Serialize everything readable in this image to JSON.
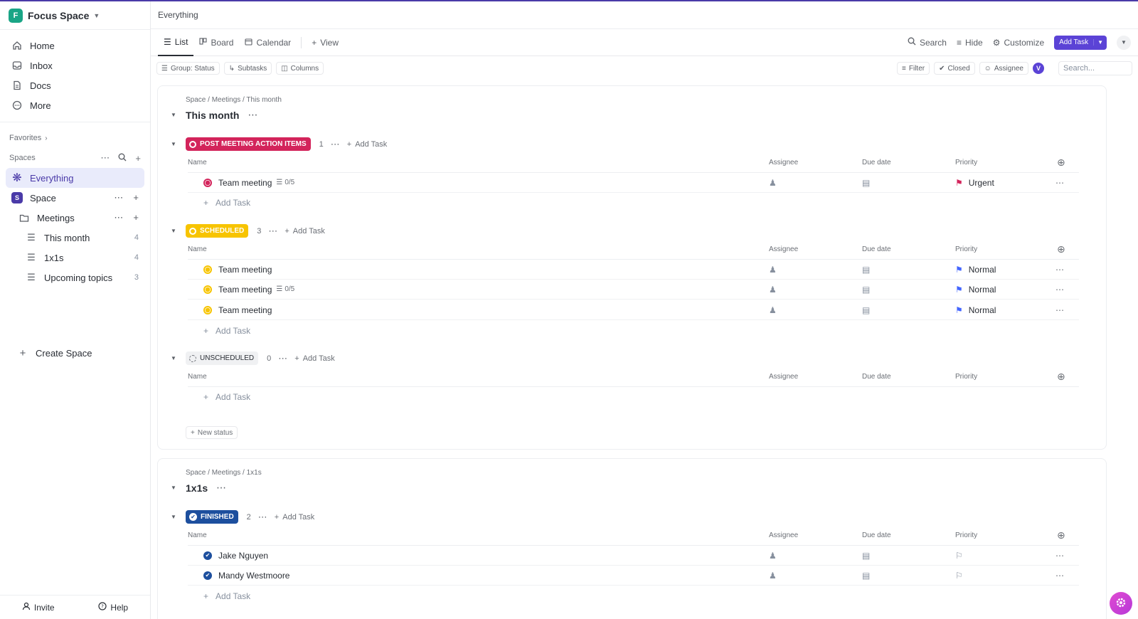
{
  "workspace": {
    "initial": "F",
    "name": "Focus Space"
  },
  "nav": {
    "home": "Home",
    "inbox": "Inbox",
    "docs": "Docs",
    "more": "More"
  },
  "sidebar": {
    "favorites": "Favorites",
    "spaces": "Spaces",
    "everything": "Everything",
    "space": {
      "initial": "S",
      "name": "Space"
    },
    "folder": "Meetings",
    "lists": [
      {
        "name": "This month",
        "count": "4"
      },
      {
        "name": "1x1s",
        "count": "4"
      },
      {
        "name": "Upcoming topics",
        "count": "3"
      }
    ],
    "create_space": "Create Space",
    "invite": "Invite",
    "help": "Help"
  },
  "header": {
    "breadcrumb": "Everything"
  },
  "views": {
    "list": "List",
    "board": "Board",
    "calendar": "Calendar",
    "add_view": "View",
    "search": "Search",
    "hide": "Hide",
    "customize": "Customize",
    "add_task": "Add Task"
  },
  "filters": {
    "group": "Group: Status",
    "subtasks": "Subtasks",
    "columns": "Columns",
    "filter": "Filter",
    "closed": "Closed",
    "assignee": "Assignee",
    "avatar": "V",
    "search_placeholder": "Search..."
  },
  "columns": {
    "name": "Name",
    "assignee": "Assignee",
    "due": "Due date",
    "priority": "Priority"
  },
  "add_task": "Add Task",
  "new_status": "New status",
  "list1": {
    "crumb": "Space / Meetings / This month",
    "title": "This month",
    "groups": [
      {
        "label": "POST MEETING ACTION ITEMS",
        "count": "1",
        "color": "#d3245b",
        "tasks": [
          {
            "name": "Team meeting",
            "sub": "0/5",
            "priority": "Urgent",
            "flag": "#d3245b"
          }
        ]
      },
      {
        "label": "SCHEDULED",
        "count": "3",
        "color": "#f7c400",
        "tasks": [
          {
            "name": "Team meeting",
            "sub": "",
            "priority": "Normal",
            "flag": "#4466ff"
          },
          {
            "name": "Team meeting",
            "sub": "0/5",
            "priority": "Normal",
            "flag": "#4466ff"
          },
          {
            "name": "Team meeting",
            "sub": "",
            "priority": "Normal",
            "flag": "#4466ff"
          }
        ]
      },
      {
        "label": "UNSCHEDULED",
        "count": "0",
        "color": "#f0f1f3",
        "tasks": []
      }
    ]
  },
  "list2": {
    "crumb": "Space / Meetings / 1x1s",
    "title": "1x1s",
    "groups": [
      {
        "label": "FINISHED",
        "count": "2",
        "color": "#1d4f9e",
        "tasks": [
          {
            "name": "Jake Nguyen"
          },
          {
            "name": "Mandy Westmoore"
          }
        ]
      }
    ]
  }
}
